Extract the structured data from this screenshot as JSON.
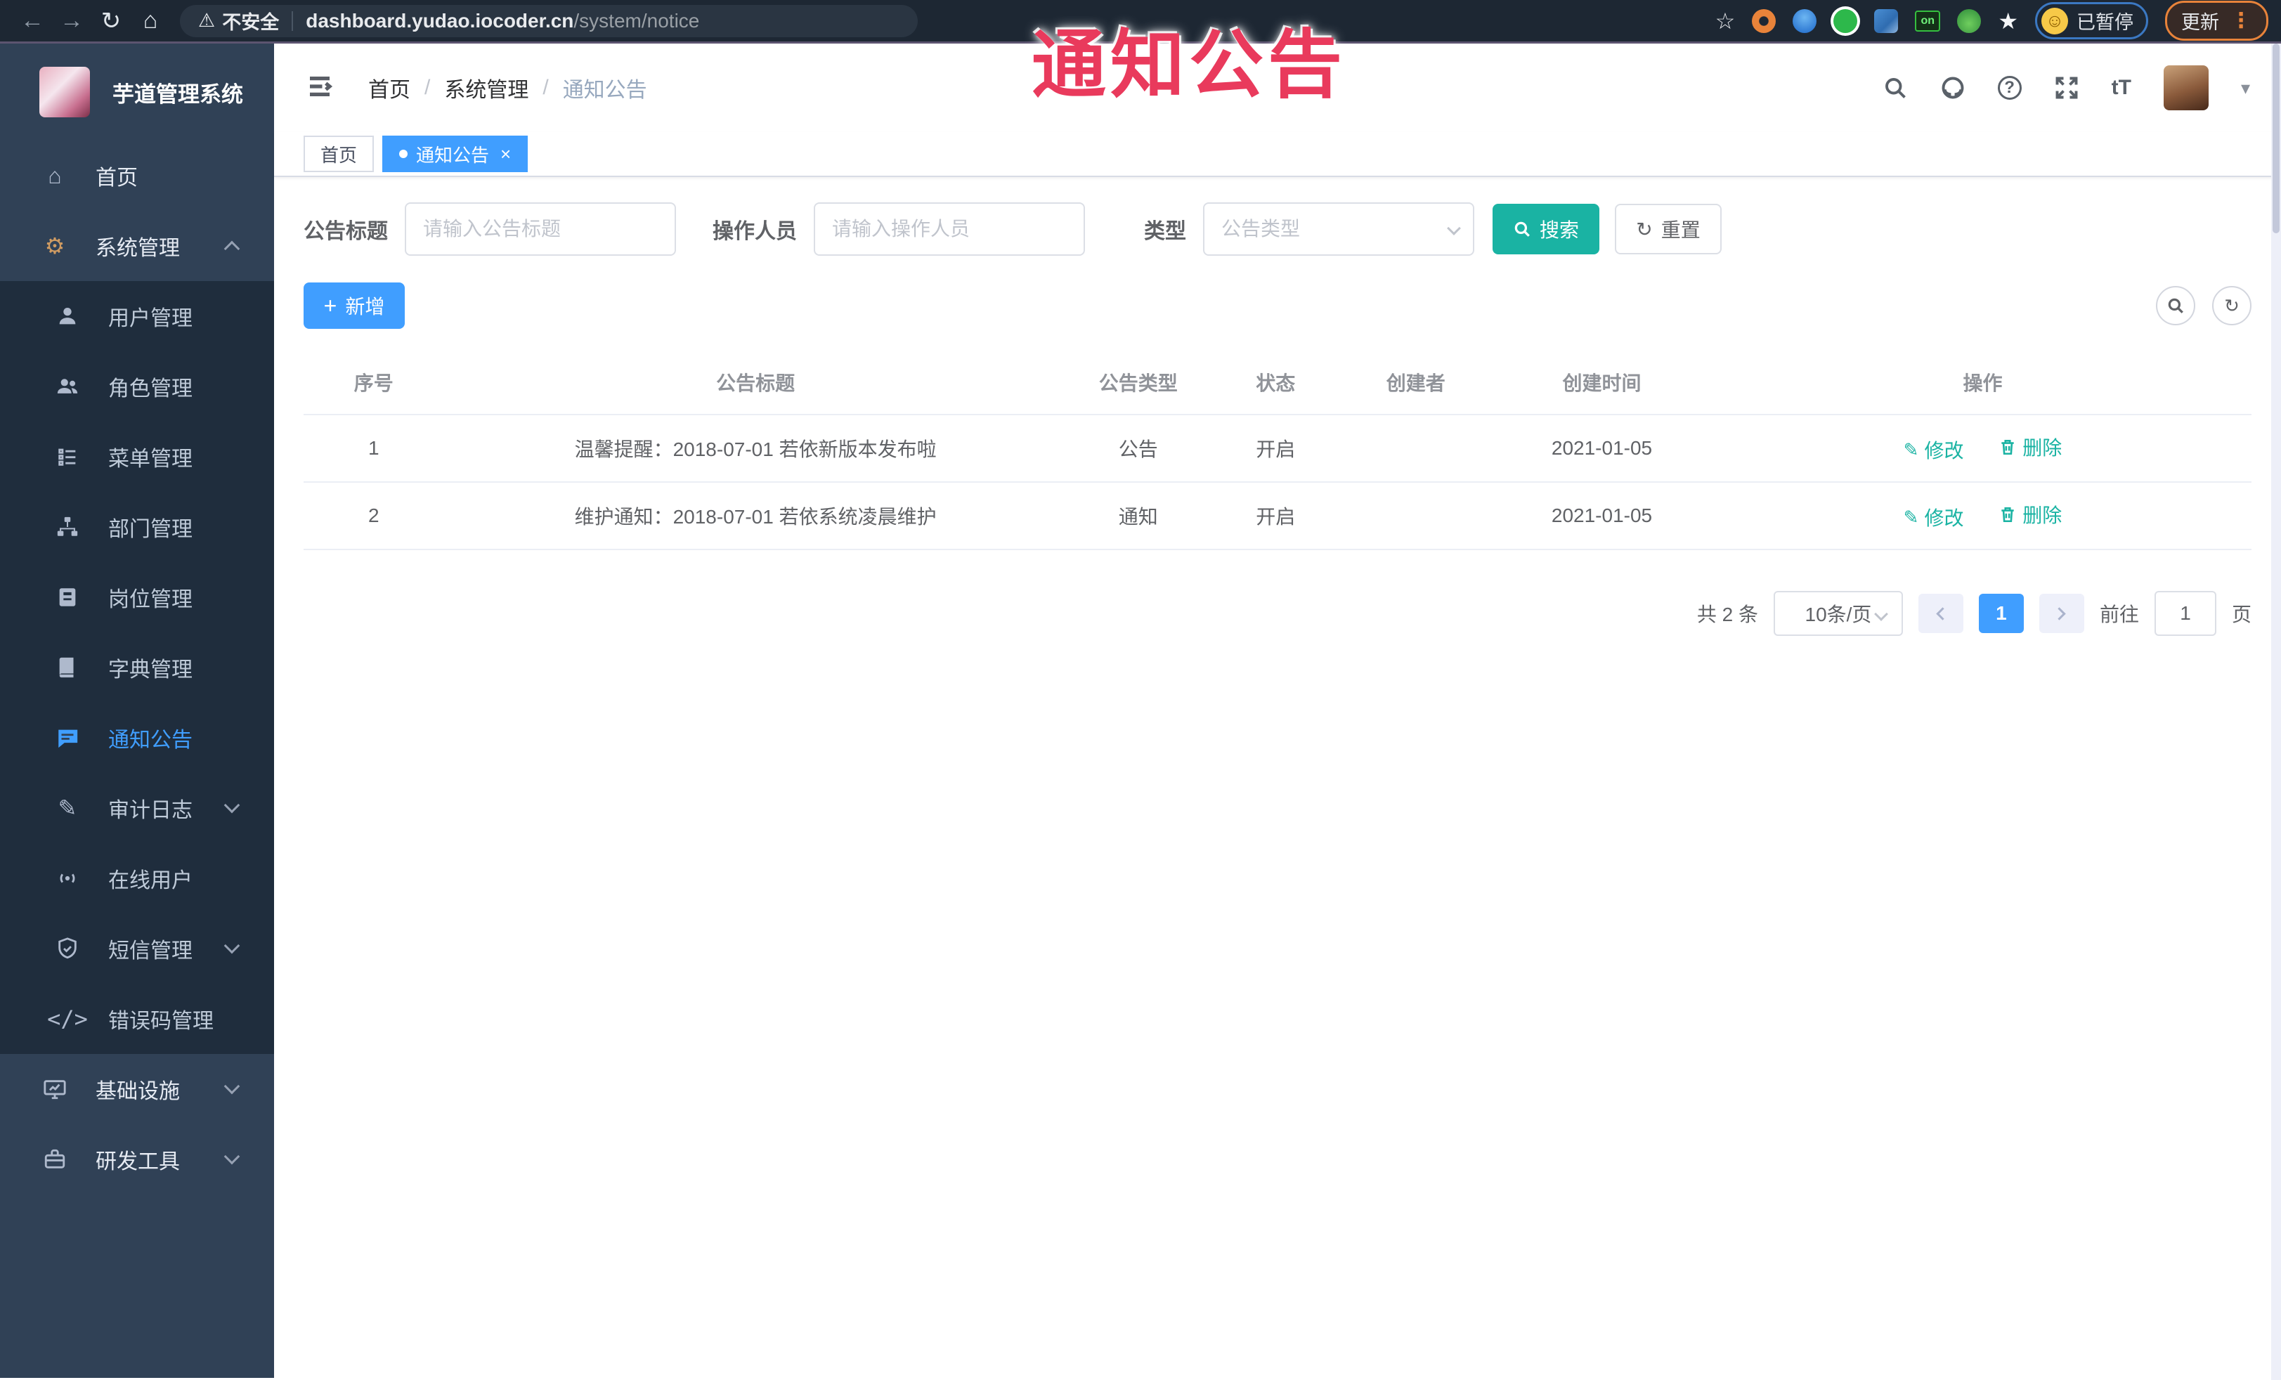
{
  "overlay": {
    "title": "通知公告"
  },
  "browser": {
    "security_label": "不安全",
    "url_domain": "dashboard.yudao.iocoder.cn",
    "url_path": "/system/notice",
    "on_badge": "on",
    "paused_label": "已暂停",
    "update_label": "更新"
  },
  "icons": {
    "back": "←",
    "forward": "→",
    "reload": "↻",
    "home": "⌂",
    "warning": "⚠",
    "star": "☆",
    "smiley": "☺",
    "kebab": "⋮",
    "home_menu": "⌂",
    "gear": "⚙",
    "pencil": "✎",
    "code": "</>",
    "caret_down": "▾",
    "font_size": "tT",
    "plus": "+",
    "close": "×",
    "question": "?",
    "refresh": "↻"
  },
  "sidebar": {
    "logo_title": "芋道管理系统",
    "items": [
      {
        "label": "首页"
      },
      {
        "label": "系统管理"
      },
      {
        "label": "用户管理"
      },
      {
        "label": "角色管理"
      },
      {
        "label": "菜单管理"
      },
      {
        "label": "部门管理"
      },
      {
        "label": "岗位管理"
      },
      {
        "label": "字典管理"
      },
      {
        "label": "通知公告"
      },
      {
        "label": "审计日志"
      },
      {
        "label": "在线用户"
      },
      {
        "label": "短信管理"
      },
      {
        "label": "错误码管理"
      },
      {
        "label": "基础设施"
      },
      {
        "label": "研发工具"
      }
    ]
  },
  "header": {
    "breadcrumb": {
      "home": "首页",
      "section": "系统管理",
      "current": "通知公告"
    }
  },
  "tabs": [
    {
      "label": "首页"
    },
    {
      "label": "通知公告"
    }
  ],
  "filters": {
    "title_label": "公告标题",
    "title_placeholder": "请输入公告标题",
    "operator_label": "操作人员",
    "operator_placeholder": "请输入操作人员",
    "type_label": "类型",
    "type_placeholder": "公告类型",
    "search_label": "搜索",
    "reset_label": "重置"
  },
  "toolbar": {
    "add_label": "新增"
  },
  "table": {
    "columns": [
      "序号",
      "公告标题",
      "公告类型",
      "状态",
      "创建者",
      "创建时间",
      "操作"
    ],
    "rows": [
      {
        "no": "1",
        "title": "温馨提醒：2018-07-01 若依新版本发布啦",
        "type": "公告",
        "status": "开启",
        "creator": "",
        "created": "2021-01-05",
        "edit": "修改",
        "delete": "删除"
      },
      {
        "no": "2",
        "title": "维护通知：2018-07-01 若依系统凌晨维护",
        "type": "通知",
        "status": "开启",
        "creator": "",
        "created": "2021-01-05",
        "edit": "修改",
        "delete": "删除"
      }
    ]
  },
  "pagination": {
    "total": "共 2 条",
    "page_size": "10条/页",
    "current": "1",
    "goto_label": "前往",
    "goto_value": "1",
    "page_label": "页"
  },
  "colors": {
    "accent_blue": "#409eff",
    "accent_teal": "#1ab3a3",
    "overlay_red": "#e93a5c",
    "sidebar_bg": "#304156",
    "submenu_bg": "#1f2d3d",
    "chrome_bg": "#1d2733"
  }
}
